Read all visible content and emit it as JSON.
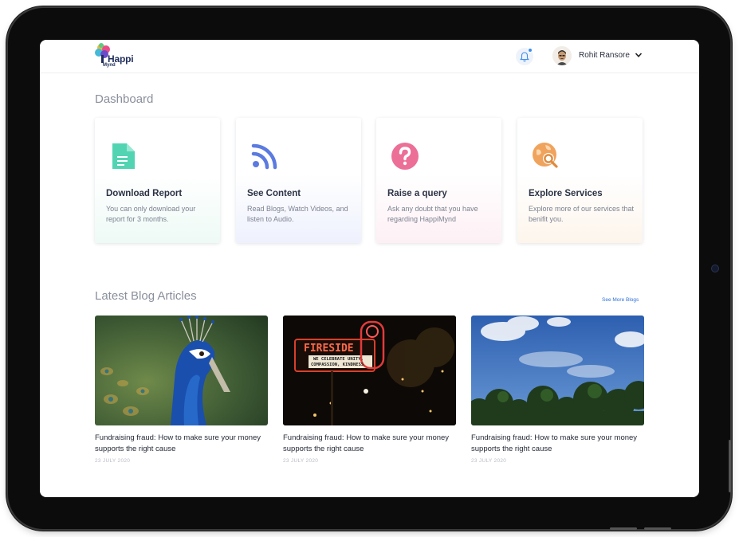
{
  "header": {
    "logo_word": "Happi",
    "logo_sub": "Mynd",
    "user_name": "Rohit Ransore"
  },
  "dashboard": {
    "title": "Dashboard",
    "cards": [
      {
        "title": "Download Report",
        "desc": "You can only download your report for 3 months.",
        "icon": "document-icon",
        "color": "#4fd1b0"
      },
      {
        "title": "See Content",
        "desc": "Read Blogs, Watch Videos, and listen to Audio.",
        "icon": "rss-icon",
        "color": "#5b7be0"
      },
      {
        "title": "Raise a query",
        "desc": "Ask any doubt that you have regarding HappiMynd",
        "icon": "question-icon",
        "color": "#ec6f98"
      },
      {
        "title": "Explore Services",
        "desc": "Explore more of our services that benifit you.",
        "icon": "globe-search-icon",
        "color": "#f0a35c"
      }
    ]
  },
  "blogs": {
    "title": "Latest Blog Articles",
    "see_more": "See More Blogs",
    "items": [
      {
        "title": "Fundraising fraud: How to make sure your money supports the right cause",
        "date": "23 JULY 2020",
        "image": "peacock-photo"
      },
      {
        "title": "Fundraising fraud: How to make sure your money supports the right cause",
        "date": "23 JULY 2020",
        "image": "fireside-sign-photo",
        "sign_main": "FIRESIDE",
        "sign_sub1": "WE CELEBRATE UNITY,",
        "sign_sub2": "COMPASSION, KINDNESS"
      },
      {
        "title": "Fundraising fraud: How to make sure your money supports the right cause",
        "date": "23 JULY 2020",
        "image": "sky-trees-photo"
      }
    ]
  }
}
